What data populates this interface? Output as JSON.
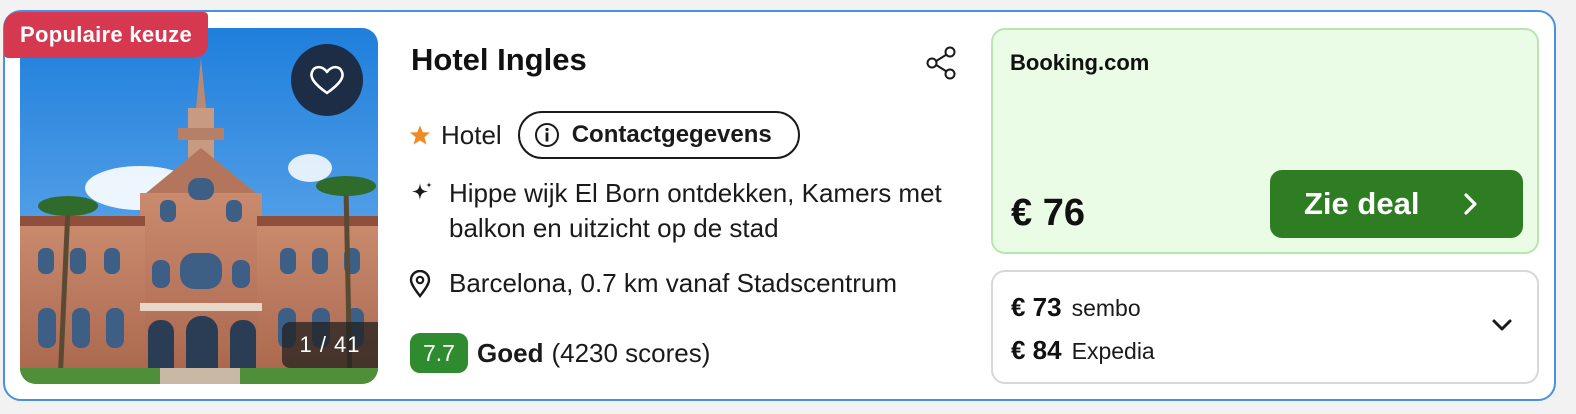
{
  "listing": {
    "badge": "Populaire keuze",
    "photo_counter": "1 / 41",
    "hotel_name": "Hotel Ingles",
    "type": "Hotel",
    "contact_label": "Contactgegevens",
    "description": "Hippe wijk El Born ontdekken, Kamers met balkon en uitzicht op de stad",
    "location": "Barcelona, 0.7 km vanaf Stadscentrum",
    "rating": {
      "score": "7.7",
      "label": "Goed",
      "count": "(4230 scores)"
    }
  },
  "deal": {
    "provider": "Booking.com",
    "price": "€ 76",
    "button_label": "Zie deal"
  },
  "alternatives": [
    {
      "price": "€ 73",
      "provider": "sembo"
    },
    {
      "price": "€ 84",
      "provider": "Expedia"
    }
  ],
  "colors": {
    "card_border": "#4a90e2",
    "badge_bg": "#d6394f",
    "deal_bg": "#eafbe6",
    "deal_button": "#2e7d23",
    "score_bg": "#2e8b2e",
    "star": "#f08a24"
  },
  "icons": {
    "favorite": "heart-icon",
    "share": "share-icon",
    "type": "star-icon",
    "contact": "info-icon",
    "description": "sparkle-icon",
    "location": "map-pin-icon",
    "deal_button": "chevron-right-icon",
    "alternatives": "chevron-down-icon"
  }
}
